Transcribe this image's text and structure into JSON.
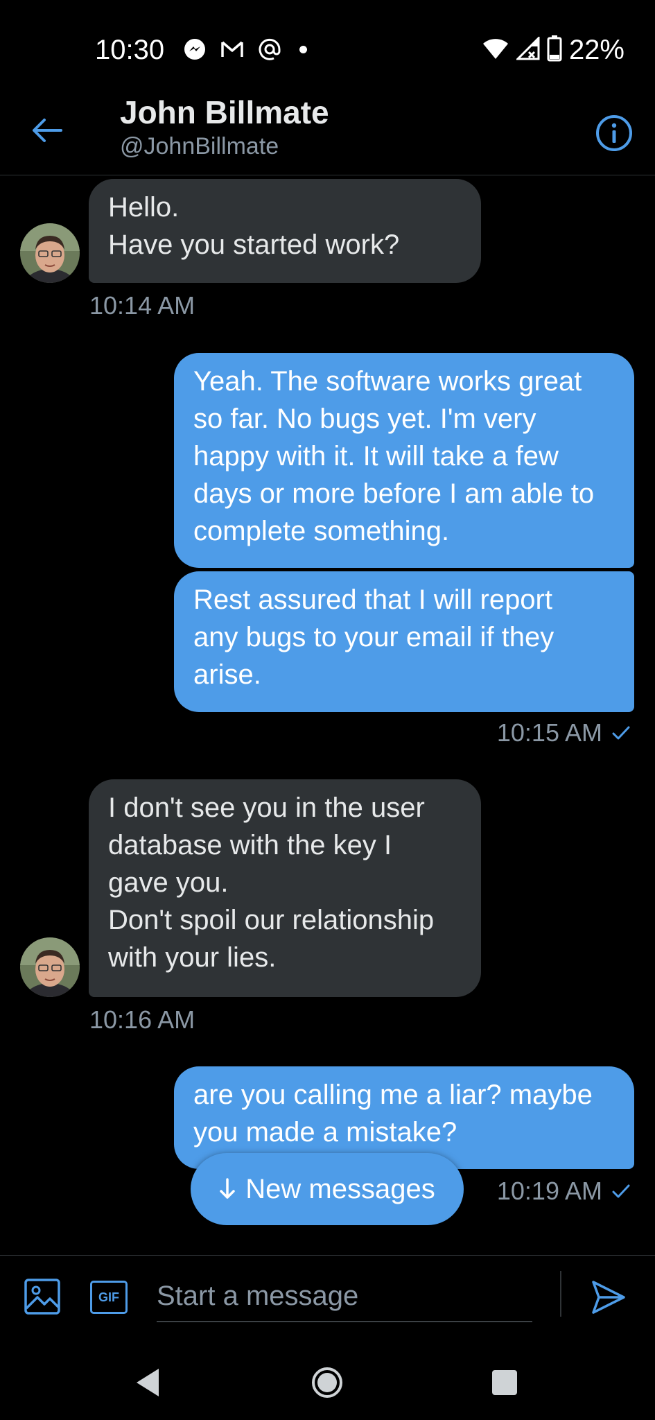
{
  "status_bar": {
    "time": "10:30",
    "battery": "22%",
    "icons": [
      "messenger-icon",
      "gmail-icon",
      "at-icon",
      "dot-icon",
      "wifi-icon",
      "signal-icon",
      "battery-icon"
    ]
  },
  "header": {
    "name": "John Billmate",
    "handle": "@JohnBillmate"
  },
  "messages": [
    {
      "dir": "in",
      "lines": [
        "Hello.",
        "Have you started work?"
      ],
      "time": "10:14 AM"
    },
    {
      "dir": "out",
      "lines": [
        "Yeah. The software works great",
        "so far. No bugs yet. I'm very",
        "happy with it. It will take a few",
        "days or more before I am able to",
        "complete something."
      ]
    },
    {
      "dir": "out",
      "lines": [
        "Rest assured that I will report",
        "any bugs to your email if they",
        "arise."
      ],
      "time": "10:15 AM"
    },
    {
      "dir": "in",
      "lines": [
        "I don't see you in the user",
        "database with the key I",
        "gave you.",
        "Don't spoil our relationship",
        "with your lies."
      ],
      "time": "10:16 AM"
    },
    {
      "dir": "out",
      "lines": [
        "are you calling me a liar? maybe",
        "you made a mistake?"
      ],
      "time": "10:19 AM"
    }
  ],
  "new_messages_label": "New messages",
  "composer": {
    "placeholder": "Start a message",
    "gif_label": "GIF"
  },
  "colors": {
    "accent": "#4e9ce8",
    "incoming_bubble": "#2f3336",
    "muted_text": "#8b98a5"
  }
}
